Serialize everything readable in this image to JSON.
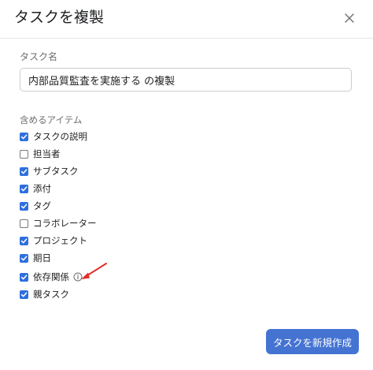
{
  "dialog": {
    "title": "タスクを複製",
    "close_icon": "close-icon",
    "name_label": "タスク名",
    "name_value": "内部品質監査を実施する の複製",
    "include_label": "含めるアイテム",
    "items": [
      {
        "label": "タスクの説明",
        "checked": true
      },
      {
        "label": "担当者",
        "checked": false
      },
      {
        "label": "サブタスク",
        "checked": true
      },
      {
        "label": "添付",
        "checked": true
      },
      {
        "label": "タグ",
        "checked": true
      },
      {
        "label": "コラボレーター",
        "checked": false
      },
      {
        "label": "プロジェクト",
        "checked": true
      },
      {
        "label": "期日",
        "checked": true
      },
      {
        "label": "依存関係",
        "checked": true,
        "icon": "info-icon"
      },
      {
        "label": "親タスク",
        "checked": true
      }
    ],
    "create_button": "タスクを新規作成"
  },
  "colors": {
    "accent": "#4573d2",
    "checkbox": "#2f6fdf",
    "annotation_arrow": "#e0302a"
  }
}
